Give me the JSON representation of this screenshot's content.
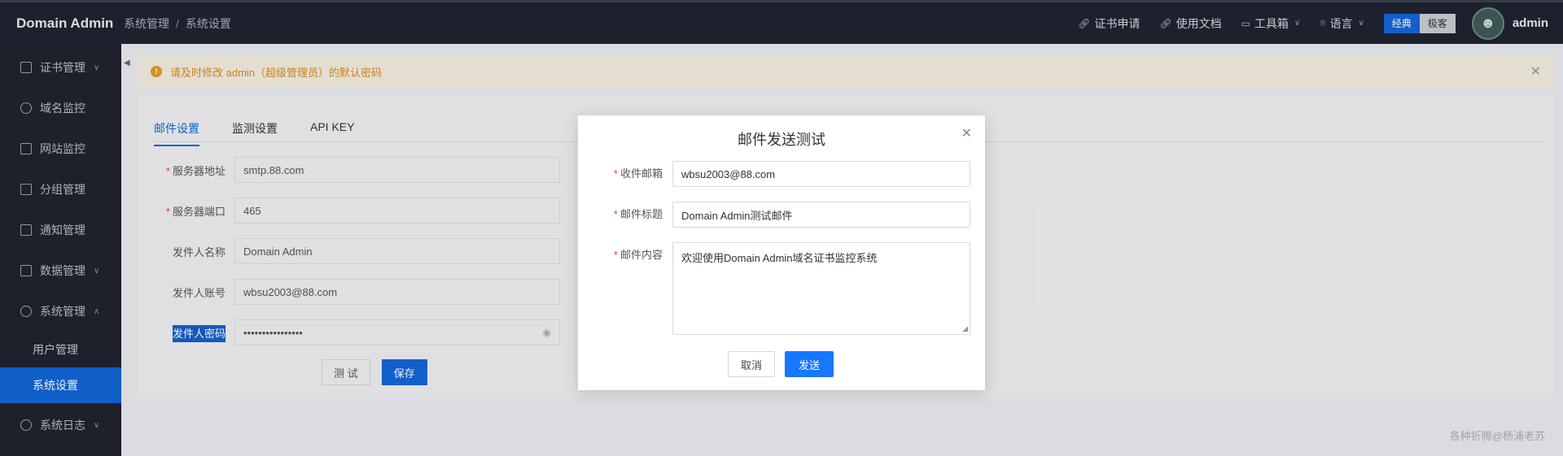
{
  "app": {
    "title": "Domain Admin"
  },
  "breadcrumb": [
    "系统管理",
    "系统设置"
  ],
  "topnav": {
    "links": [
      {
        "icon": "link-icon",
        "label": "证书申请"
      },
      {
        "icon": "link-icon",
        "label": "使用文档"
      },
      {
        "icon": "toolbox-icon",
        "label": "工具箱"
      },
      {
        "icon": "location-icon",
        "label": "语言"
      }
    ],
    "theme": {
      "classic": "经典",
      "minimal": "极客"
    },
    "user": "admin"
  },
  "sidebar": {
    "items": [
      {
        "label": "证书管理",
        "icon": "document-icon",
        "arrow": "down"
      },
      {
        "label": "域名监控",
        "icon": "database-icon"
      },
      {
        "label": "网站监控",
        "icon": "monitor-icon"
      },
      {
        "label": "分组管理",
        "icon": "folder-icon"
      },
      {
        "label": "通知管理",
        "icon": "mail-icon"
      },
      {
        "label": "数据管理",
        "icon": "briefcase-icon",
        "arrow": "down"
      },
      {
        "label": "系统管理",
        "icon": "gear-icon",
        "arrow": "up"
      }
    ],
    "subitems": [
      {
        "label": "用户管理"
      },
      {
        "label": "系统设置",
        "active": true
      }
    ],
    "log": {
      "label": "系统日志",
      "icon": "clock-icon",
      "arrow": "down"
    }
  },
  "alert": {
    "text": "请及时修改 admin（超级管理员）的默认密码"
  },
  "tabs": [
    {
      "label": "邮件设置",
      "active": true
    },
    {
      "label": "监测设置"
    },
    {
      "label": "API KEY"
    }
  ],
  "mail_form": {
    "fields": [
      {
        "label": "服务器地址",
        "required": true,
        "value": "smtp.88.com"
      },
      {
        "label": "服务器端口",
        "required": true,
        "value": "465"
      },
      {
        "label": "发件人名称",
        "required": false,
        "value": "Domain Admin"
      },
      {
        "label": "发件人账号",
        "required": false,
        "value": "wbsu2003@88.com"
      },
      {
        "label": "发件人密码",
        "required": false,
        "value": "••••••••••••••••"
      }
    ],
    "test_label": "测 试",
    "save_label": "保存"
  },
  "dialog": {
    "title": "邮件发送测试",
    "fields": {
      "to": {
        "label": "收件邮箱",
        "value": "wbsu2003@88.com"
      },
      "subject": {
        "label": "邮件标题",
        "value": "Domain Admin测试邮件"
      },
      "content": {
        "label": "邮件内容",
        "value": "欢迎使用Domain Admin域名证书监控系统"
      }
    },
    "cancel_label": "取消",
    "send_label": "发送"
  },
  "watermark": "各种折腾@杨浦老苏"
}
